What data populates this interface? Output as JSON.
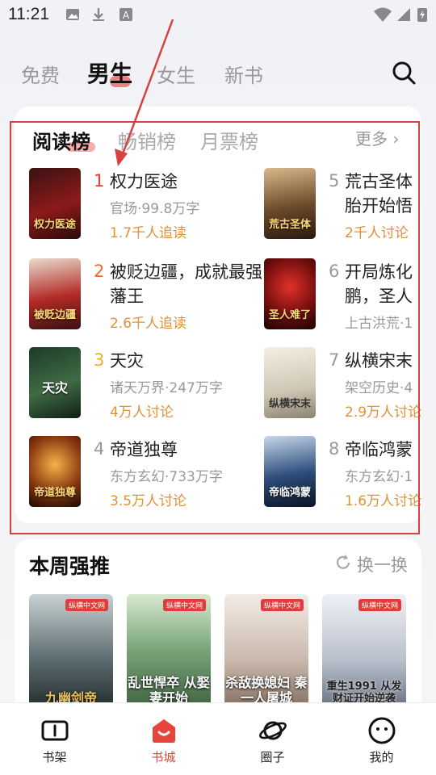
{
  "status_bar": {
    "time": "11:21"
  },
  "top_tabs": [
    "免费",
    "男生",
    "女生",
    "新书"
  ],
  "top_tab_active": 1,
  "rank_tabs": [
    "阅读榜",
    "畅销榜",
    "月票榜"
  ],
  "more_label": "更多",
  "books": [
    {
      "rank": "1",
      "title": "权力医途",
      "meta": "官场·99.8万字",
      "stat": "1.7千人追读",
      "cover_text": "权力医途"
    },
    {
      "rank": "2",
      "title": "被贬边疆，成就最强藩王",
      "meta": "",
      "stat": "2.6千人追读",
      "cover_text": "被贬边疆"
    },
    {
      "rank": "3",
      "title": "天灾",
      "meta": "诸天万界·247万字",
      "stat": "4万人讨论",
      "cover_text": "天灾"
    },
    {
      "rank": "4",
      "title": "帝道独尊",
      "meta": "东方玄幻·733万字",
      "stat": "3.5万人讨论",
      "cover_text": "帝道独尊"
    },
    {
      "rank": "5",
      "title": "荒古圣体胎开始悟",
      "meta": "",
      "stat": "2千人讨论",
      "cover_text": "荒古圣体"
    },
    {
      "rank": "6",
      "title": "开局炼化鹏，圣人",
      "meta": "上古洪荒·1",
      "stat": "",
      "cover_text": "圣人难了"
    },
    {
      "rank": "7",
      "title": "纵横宋末",
      "meta": "架空历史·4",
      "stat": "2.9万人讨论",
      "cover_text": "纵横宋末"
    },
    {
      "rank": "8",
      "title": "帝临鸿蒙",
      "meta": "东方玄幻·1",
      "stat": "1.6万人讨论",
      "cover_text": "帝临鸿蒙"
    }
  ],
  "weekly": {
    "title": "本周强推",
    "refresh_label": "换一换",
    "items": [
      {
        "cover_text": "九幽剑帝",
        "badge": "纵横中文网"
      },
      {
        "cover_text": "乱世悍卒 从娶妻开始",
        "badge": "纵横中文网"
      },
      {
        "cover_text": "杀敌换媳妇 秦一人屠城",
        "badge": "纵横中文网"
      },
      {
        "cover_text": "重生1991 从发财证开始逆袭",
        "badge": "纵横中文网"
      }
    ]
  },
  "bottom_nav": [
    "书架",
    "书城",
    "圈子",
    "我的"
  ],
  "bottom_nav_active": 1,
  "colors": {
    "accent": "#e6453b",
    "stat": "#e0913a",
    "highlight_border": "#d94040"
  }
}
